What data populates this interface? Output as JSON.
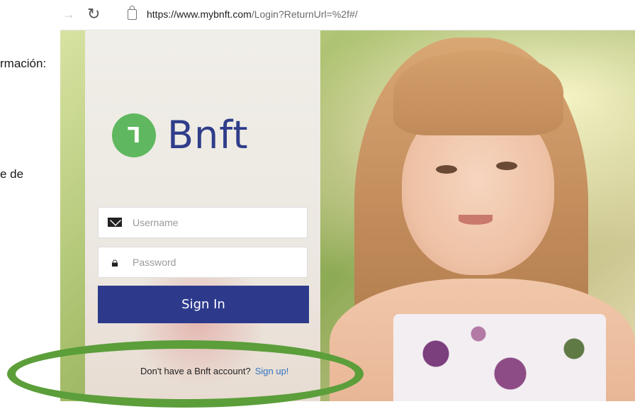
{
  "document_side": {
    "line1": "rmación:",
    "line2": "e de"
  },
  "browser": {
    "url_host": "https://www.mybnft.com",
    "url_path": "/Login?ReturnUrl=%2f#/"
  },
  "login": {
    "logo_text": "Bnft",
    "username_placeholder": "Username",
    "password_placeholder": "Password",
    "signin_label": "Sign In",
    "signup_prompt": "Don't have a Bnft account?",
    "signup_link": "Sign up!"
  },
  "colors": {
    "brand_blue": "#2d3a8c",
    "logo_green": "#5fb85f",
    "ring_green": "#5b9e3a",
    "link_blue": "#2f74c0"
  }
}
